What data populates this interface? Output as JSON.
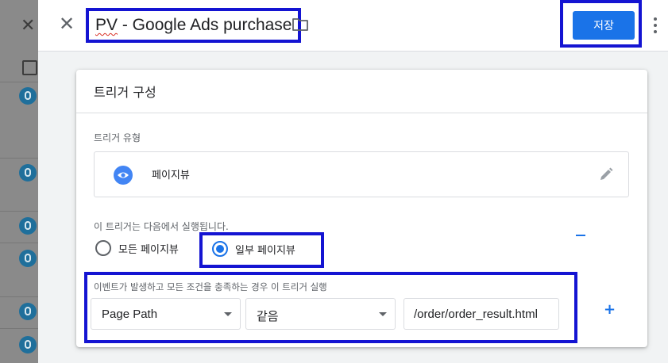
{
  "background": {
    "close_glyph": "✕"
  },
  "header": {
    "close_glyph": "✕",
    "title": "PV - Google Ads purchase",
    "title_prefix": "PV",
    "title_rest": " - Google Ads purchase",
    "folder_icon": "folder-icon",
    "save_label": "저장",
    "more_icon": "more-vert-icon"
  },
  "card": {
    "title": "트리거 구성",
    "trigger_type_label": "트리거 유형",
    "trigger_type": "페이지뷰",
    "fires_on_label": "이 트리거는 다음에서 실행됩니다.",
    "radio_all_label": "모든 페이지뷰",
    "radio_some_label": "일부 페이지뷰",
    "selected_radio": "일부 페이지뷰",
    "condition_label": "이벤트가 발생하고 모든 조건을 충족하는 경우 이 트리거 실행",
    "condition": {
      "variable": "Page Path",
      "operator": "같음",
      "value": "/order/order_result.html"
    },
    "minus_glyph": "-",
    "plus_glyph": "+"
  },
  "colors": {
    "accent": "#1a73e8",
    "highlight_box": "#1414d2",
    "pageview_icon": "#4285f4"
  }
}
